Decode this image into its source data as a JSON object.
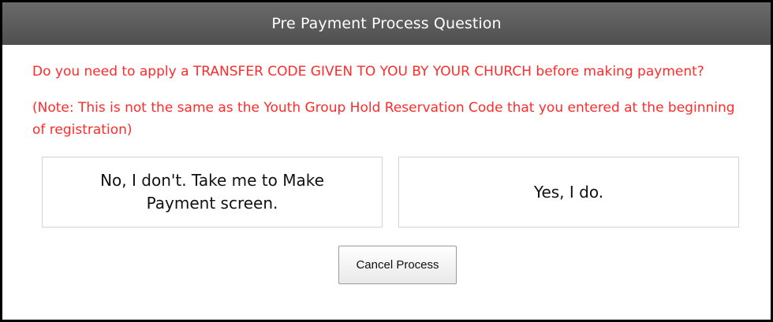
{
  "dialog": {
    "title": "Pre Payment Process Question",
    "question": "Do you need to apply a TRANSFER CODE GIVEN TO YOU BY YOUR CHURCH before making payment?",
    "note": "(Note: This is not the same as the Youth Group Hold Reservation Code that you entered at the beginning of registration)",
    "options": {
      "no_label": "No, I don't. Take me to Make Payment screen.",
      "yes_label": "Yes, I do."
    },
    "cancel_label": "Cancel Process"
  },
  "colors": {
    "title_bar": "#5a5a5a",
    "prompt_text": "#ff2b2b",
    "border": "#000000"
  }
}
